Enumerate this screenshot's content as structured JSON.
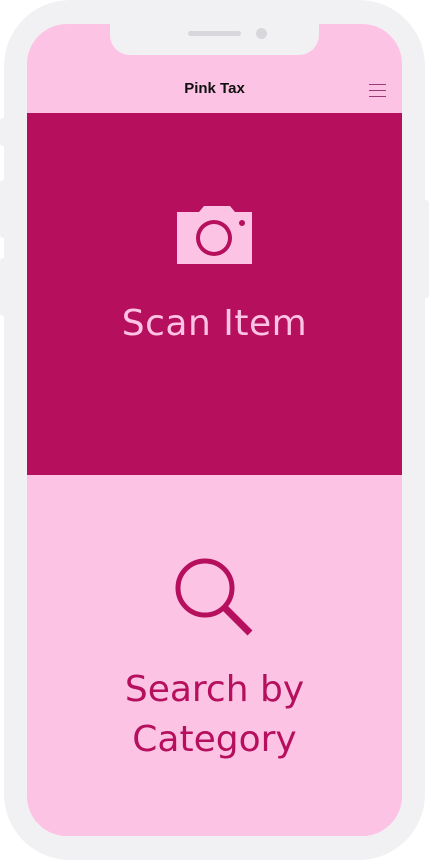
{
  "app": {
    "title": "Pink Tax"
  },
  "header": {
    "menu_icon": "hamburger-menu-icon"
  },
  "scan": {
    "label": "Scan Item",
    "icon": "camera-icon"
  },
  "search": {
    "label_line1": "Search by",
    "label_line2": "Category",
    "icon": "magnifier-icon"
  },
  "colors": {
    "primary": "#b50f5d",
    "light_pink": "#fdc3e4",
    "frame": "#f1f1f3"
  }
}
